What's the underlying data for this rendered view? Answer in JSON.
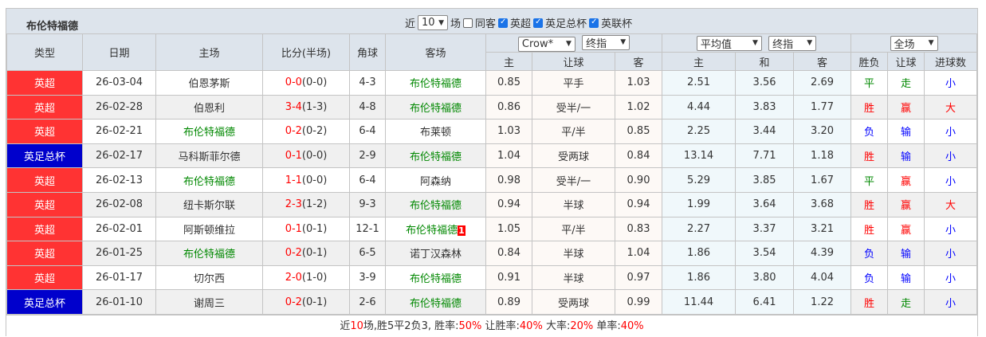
{
  "team": "布伦特福德",
  "filters": {
    "near": "近",
    "count": "10",
    "unit": "场",
    "same_home": "同客",
    "leagues": [
      "英超",
      "英足总杯",
      "英联杯"
    ]
  },
  "headers": {
    "type": "类型",
    "date": "日期",
    "home": "主场",
    "score": "比分(半场)",
    "corner": "角球",
    "away": "客场",
    "company": "Crow*",
    "handicap_mode": "终指",
    "avg": "平均值",
    "euro_mode": "终指",
    "range": "全场",
    "h": "主",
    "hcp": "让球",
    "a": "客",
    "eh": "主",
    "ed": "和",
    "ea": "客",
    "wl": "胜负",
    "hr": "让球",
    "goals": "进球数"
  },
  "colors": {
    "epl": "#ff3333",
    "facup": "#0000cc",
    "win": "#ff0000",
    "draw": "#008800",
    "lose": "#0000ff"
  },
  "rows": [
    {
      "league": "英超",
      "lc": "epl",
      "date": "26-03-04",
      "home": "伯恩茅斯",
      "hg": false,
      "ft": "0-0",
      "ht": "(0-0)",
      "corner": "4-3",
      "away": "布伦特福德",
      "ag": true,
      "oh": "0.85",
      "hcp": "平手",
      "oa": "1.03",
      "eh": "2.51",
      "ed": "3.56",
      "ea": "2.69",
      "wl": "平",
      "hr": "走",
      "gl": "小"
    },
    {
      "league": "英超",
      "lc": "epl",
      "date": "26-02-28",
      "home": "伯恩利",
      "hg": false,
      "ft": "3-4",
      "ht": "(1-3)",
      "corner": "4-8",
      "away": "布伦特福德",
      "ag": true,
      "oh": "0.86",
      "hcp": "受半/一",
      "oa": "1.02",
      "eh": "4.44",
      "ed": "3.83",
      "ea": "1.77",
      "wl": "胜",
      "hr": "赢",
      "gl": "大"
    },
    {
      "league": "英超",
      "lc": "epl",
      "date": "26-02-21",
      "home": "布伦特福德",
      "hg": true,
      "ft": "0-2",
      "ht": "(0-2)",
      "corner": "6-4",
      "away": "布莱顿",
      "ag": false,
      "oh": "1.03",
      "hcp": "平/半",
      "oa": "0.85",
      "eh": "2.25",
      "ed": "3.44",
      "ea": "3.20",
      "wl": "负",
      "hr": "输",
      "gl": "小"
    },
    {
      "league": "英足总杯",
      "lc": "facup",
      "date": "26-02-17",
      "home": "马科斯菲尔德",
      "hg": false,
      "ft": "0-1",
      "ht": "(0-0)",
      "corner": "2-9",
      "away": "布伦特福德",
      "ag": true,
      "oh": "1.04",
      "hcp": "受两球",
      "oa": "0.84",
      "eh": "13.14",
      "ed": "7.71",
      "ea": "1.18",
      "wl": "胜",
      "hr": "输",
      "gl": "小"
    },
    {
      "league": "英超",
      "lc": "epl",
      "date": "26-02-13",
      "home": "布伦特福德",
      "hg": true,
      "ft": "1-1",
      "ht": "(0-0)",
      "corner": "6-4",
      "away": "阿森纳",
      "ag": false,
      "oh": "0.98",
      "hcp": "受半/一",
      "oa": "0.90",
      "eh": "5.29",
      "ed": "3.85",
      "ea": "1.67",
      "wl": "平",
      "hr": "赢",
      "gl": "小"
    },
    {
      "league": "英超",
      "lc": "epl",
      "date": "26-02-08",
      "home": "纽卡斯尔联",
      "hg": false,
      "ft": "2-3",
      "ht": "(1-2)",
      "corner": "9-3",
      "away": "布伦特福德",
      "ag": true,
      "oh": "0.94",
      "hcp": "半球",
      "oa": "0.94",
      "eh": "1.99",
      "ed": "3.64",
      "ea": "3.68",
      "wl": "胜",
      "hr": "赢",
      "gl": "大"
    },
    {
      "league": "英超",
      "lc": "epl",
      "date": "26-02-01",
      "home": "阿斯顿维拉",
      "hg": false,
      "ft": "0-1",
      "ht": "(0-1)",
      "corner": "12-1",
      "away": "布伦特福德",
      "ag": true,
      "red": "1",
      "oh": "1.05",
      "hcp": "平/半",
      "oa": "0.83",
      "eh": "2.27",
      "ed": "3.37",
      "ea": "3.21",
      "wl": "胜",
      "hr": "赢",
      "gl": "小"
    },
    {
      "league": "英超",
      "lc": "epl",
      "date": "26-01-25",
      "home": "布伦特福德",
      "hg": true,
      "ft": "0-2",
      "ht": "(0-1)",
      "corner": "6-5",
      "away": "诺丁汉森林",
      "ag": false,
      "oh": "0.84",
      "hcp": "半球",
      "oa": "1.04",
      "eh": "1.86",
      "ed": "3.54",
      "ea": "4.39",
      "wl": "负",
      "hr": "输",
      "gl": "小"
    },
    {
      "league": "英超",
      "lc": "epl",
      "date": "26-01-17",
      "home": "切尔西",
      "hg": false,
      "ft": "2-0",
      "ht": "(1-0)",
      "corner": "3-9",
      "away": "布伦特福德",
      "ag": true,
      "oh": "0.91",
      "hcp": "半球",
      "oa": "0.97",
      "eh": "1.86",
      "ed": "3.80",
      "ea": "4.04",
      "wl": "负",
      "hr": "输",
      "gl": "小"
    },
    {
      "league": "英足总杯",
      "lc": "facup",
      "date": "26-01-10",
      "home": "谢周三",
      "hg": false,
      "ft": "0-2",
      "ht": "(0-1)",
      "corner": "2-6",
      "away": "布伦特福德",
      "ag": true,
      "oh": "0.89",
      "hcp": "受两球",
      "oa": "0.99",
      "eh": "11.44",
      "ed": "6.41",
      "ea": "1.22",
      "wl": "胜",
      "hr": "走",
      "gl": "小"
    }
  ],
  "summary": {
    "p1": "近",
    "n": "10",
    "p2": "场,胜5平2负3, 胜率:",
    "win": "50%",
    "p3": " 让胜率:",
    "hwin": "40%",
    "p4": " 大率:",
    "big": "20%",
    "p5": " 单率:",
    "odd": "40%"
  }
}
